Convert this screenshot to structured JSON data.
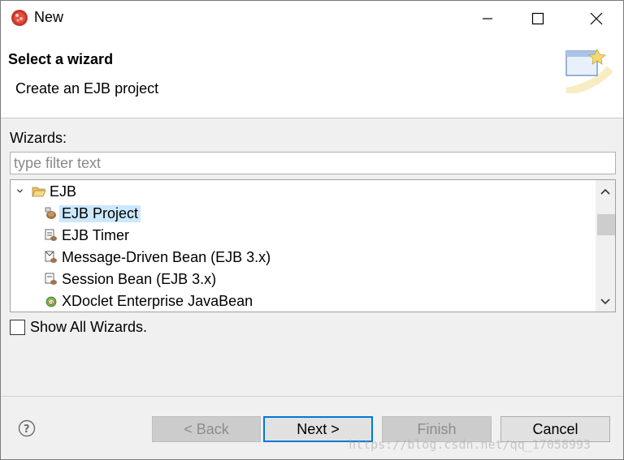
{
  "window": {
    "title": "New",
    "minimize_icon": "minimize-icon",
    "maximize_icon": "maximize-icon",
    "close_icon": "close-icon"
  },
  "header": {
    "title": "Select a wizard",
    "description": "Create an EJB project"
  },
  "wizards": {
    "label": "Wizards:",
    "filter_placeholder": "type filter text",
    "filter_value": "",
    "tree": {
      "category": "EJB",
      "items": [
        {
          "label": "EJB Project",
          "icon": "ejb-project-icon",
          "selected": true
        },
        {
          "label": "EJB Timer",
          "icon": "ejb-timer-icon",
          "selected": false
        },
        {
          "label": "Message-Driven Bean (EJB 3.x)",
          "icon": "message-driven-bean-icon",
          "selected": false
        },
        {
          "label": "Session Bean (EJB 3.x)",
          "icon": "session-bean-icon",
          "selected": false
        },
        {
          "label": "XDoclet Enterprise JavaBean",
          "icon": "xdoclet-icon",
          "selected": false
        }
      ]
    },
    "show_all_label": "Show All Wizards.",
    "show_all_checked": false
  },
  "footer": {
    "back_label": "< Back",
    "next_label": "Next >",
    "finish_label": "Finish",
    "cancel_label": "Cancel"
  },
  "watermark": "https://blog.csdn.net/qq_17058993",
  "colors": {
    "selection": "#cce8ff",
    "default_button_border": "#0078d7"
  }
}
